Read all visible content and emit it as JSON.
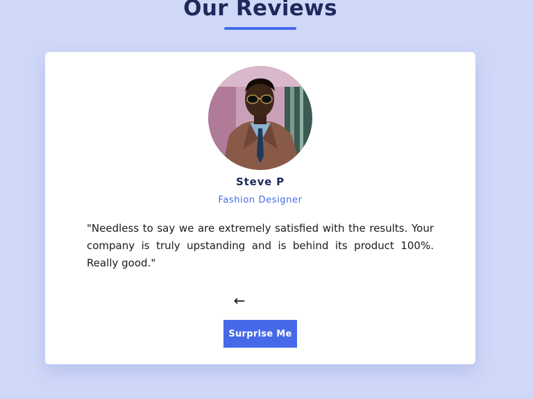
{
  "header": {
    "title": "Our Reviews"
  },
  "review": {
    "author_name": "Steve P",
    "author_job": "Fashion Designer",
    "text": "\"Needless to say we are extremely satisfied with the results. Your company is truly upstanding and is behind its product 100%. Really good.\"",
    "avatar_image": "portrait-man-sunglasses-brown-jacket"
  },
  "controls": {
    "prev_icon": "←",
    "prev_icon_name": "arrow-left-icon",
    "surprise_label": "Surprise Me"
  },
  "colors": {
    "background": "#d0d8f8",
    "accent": "#4569e8",
    "title": "#1c2a5c",
    "card": "#ffffff"
  }
}
